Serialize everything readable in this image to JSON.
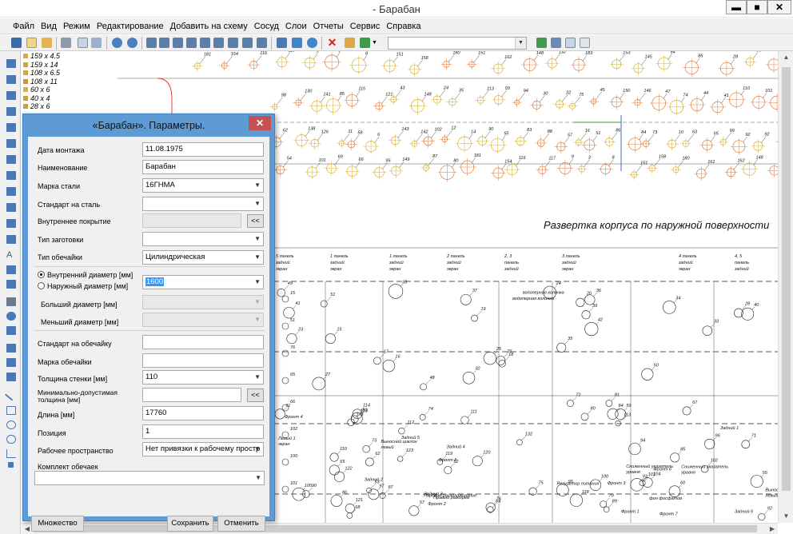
{
  "window": {
    "title": "- Барабан",
    "min_label": "▬",
    "max_label": "■",
    "close_label": "✕"
  },
  "menu": [
    "Файл",
    "Вид",
    "Режим",
    "Редактирование",
    "Добавить на схему",
    "Сосуд",
    "Слои",
    "Отчеты",
    "Сервис",
    "Справка"
  ],
  "layers": [
    {
      "label": "159 x 4.5",
      "color": "#d6a94c"
    },
    {
      "label": "159 x 14",
      "color": "#c8a83a"
    },
    {
      "label": "108 x 6.5",
      "color": "#d4a640"
    },
    {
      "label": "108 x 11",
      "color": "#e08a3c"
    },
    {
      "label": "60 x 6",
      "color": "#d2b24a"
    },
    {
      "label": "40 x 4",
      "color": "#c9a23c"
    },
    {
      "label": "28 x 6",
      "color": "#caa144"
    }
  ],
  "drawing": {
    "development_title": "Развертка корпуса по наружной поверхности",
    "top_labels": [
      "181",
      "154",
      "116",
      "117",
      "9",
      "3",
      "8",
      "151",
      "158",
      "180",
      "161",
      "162",
      "148",
      "132",
      "183",
      "153",
      "145",
      "84",
      "85",
      "28",
      "96",
      "37",
      "98",
      "130",
      "141",
      "85",
      "115",
      "121",
      "43",
      "148",
      "24",
      "35",
      "113",
      "93",
      "94",
      "30",
      "32",
      "75",
      "45",
      "150",
      "146",
      "47",
      "74",
      "44",
      "41",
      "110",
      "101",
      "36",
      "62",
      "138",
      "126",
      "11",
      "58",
      "6",
      "143",
      "142",
      "102",
      "12",
      "14",
      "90",
      "55",
      "83",
      "88",
      "57",
      "16",
      "51",
      "86",
      "84",
      "73",
      "10",
      "63",
      "65",
      "99",
      "92",
      "92",
      "79",
      "54",
      "101",
      "69",
      "66",
      "95",
      "149",
      "87",
      "80"
    ],
    "row_labels": [
      "5 панель задний экран",
      "1 панель задний экран",
      "1 панель задний экран",
      "2 панель задний экран",
      "2, 3 панель задний экран",
      "3 панель задний экран",
      "4 панель задний экран",
      "4, 5 панель задний экран"
    ],
    "mid_labels": [
      "15",
      "16",
      "17",
      "18",
      "19",
      "26",
      "23",
      "24",
      "25",
      "27",
      "28",
      "32",
      "33",
      "34",
      "35",
      "36",
      "37",
      "38",
      "39",
      "40",
      "42",
      "51",
      "50",
      "49",
      "48",
      "41",
      "20",
      "водоперная колонка",
      "водоперная колонка"
    ],
    "low_labels": [
      "Регулятор питания",
      "Фронт 1",
      "Фронт 2",
      "Фронт 3",
      "Фронт 4",
      "Фронт 5",
      "Фронт 6",
      "Фронт 7",
      "Задний 1",
      "Задний 2",
      "Задний 3",
      "Задний 4",
      "Задний 5",
      "Задний 6",
      "Левый 1 экран",
      "Правый разогрев",
      "Выносной циклон левый",
      "Выносной циклон левый",
      "Сниженный указатель уровня",
      "Сниженный указатель уровня",
      "Паровое расхолаживание",
      "фон фосфатов",
      "104",
      "105",
      "110",
      "111",
      "112",
      "131",
      "132",
      "113",
      "114",
      "119",
      "118",
      "120",
      "121",
      "123",
      "122",
      "97",
      "96",
      "95",
      "94",
      "93",
      "91",
      "92",
      "90",
      "89",
      "87",
      "86",
      "85",
      "84",
      "83",
      "81",
      "80",
      "76",
      "75",
      "74",
      "73",
      "72",
      "71",
      "70",
      "68",
      "67",
      "65",
      "64",
      "62",
      "60",
      "59",
      "57",
      "55",
      "53",
      "52",
      "102",
      "103",
      "100",
      "101"
    ]
  },
  "dialog": {
    "title": "«Барабан». Параметры.",
    "close_label": "✕",
    "fields": {
      "install_date": {
        "label": "Дата монтажа",
        "value": "11.08.1975"
      },
      "name": {
        "label": "Наименование",
        "value": "Барабан"
      },
      "steel_grade": {
        "label": "Марка стали",
        "value": "16ГНМА"
      },
      "steel_standard": {
        "label": "Стандарт на сталь",
        "value": ""
      },
      "inner_coating": {
        "label": "Внутреннее покрытие",
        "value": ""
      },
      "blank_type": {
        "label": "Тип заготовки",
        "value": ""
      },
      "shell_type": {
        "label": "Тип обечайки",
        "value": "Цилиндрическая"
      },
      "inner_diameter": {
        "label": "Внутренний диаметр [мм]",
        "value": "1600"
      },
      "outer_diameter": {
        "label": "Наружный диаметр [мм]"
      },
      "larger_diameter": {
        "label": "Больший диаметр [мм]",
        "value": ""
      },
      "smaller_diameter": {
        "label": "Меньший диаметр [мм]",
        "value": ""
      },
      "shell_standard": {
        "label": "Стандарт на обечайку",
        "value": ""
      },
      "shell_grade": {
        "label": "Марка обечайки",
        "value": ""
      },
      "wall_thickness": {
        "label": "Толщина стенки [мм]",
        "value": "110"
      },
      "min_thickness": {
        "label": "Минимально-допустимая толщина [мм]",
        "value": ""
      },
      "length": {
        "label": "Длина [мм]",
        "value": "17760"
      },
      "position": {
        "label": "Позиция",
        "value": "1"
      },
      "workspace": {
        "label": "Рабочее пространство",
        "value": "Нет привязки к рабочему простр"
      },
      "shell_set": {
        "label": "Комплект обечаек",
        "value": ""
      }
    },
    "ellipsis_label": "<<",
    "buttons": {
      "many": "Множество",
      "save": "Сохранить",
      "cancel": "Отменить"
    }
  }
}
